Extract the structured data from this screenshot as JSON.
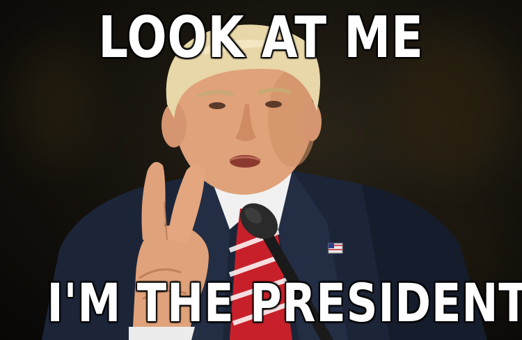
{
  "meme": {
    "top_text": "LOOK AT ME",
    "bottom_text": "I'M THE PRESIDENT NOW"
  },
  "colors": {
    "caption_fill": "#ffffff",
    "caption_stroke": "#000000",
    "background": "#14110c",
    "suit": "#1c2538",
    "skin": "#e0a27a",
    "hair": "#e8d7a8",
    "tie_red": "#c8202a"
  }
}
